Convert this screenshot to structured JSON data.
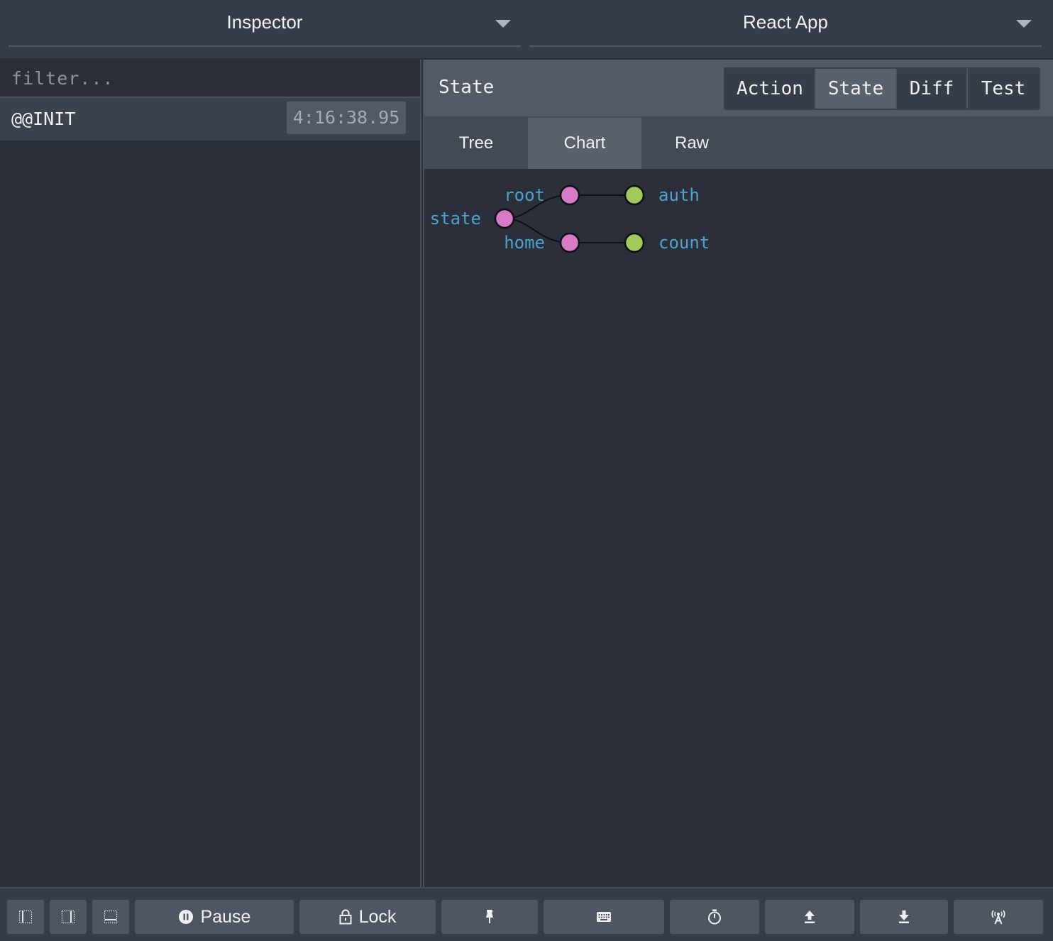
{
  "header": {
    "monitor_selector": "Inspector",
    "instance_selector": "React App"
  },
  "action_list": {
    "filter_placeholder": "filter...",
    "actions": [
      {
        "name": "@@INIT",
        "time": "4:16:38.95"
      }
    ]
  },
  "inspector": {
    "title": "State",
    "modes": [
      "Action",
      "State",
      "Diff",
      "Test"
    ],
    "active_mode": "State",
    "tabs": [
      "Tree",
      "Chart",
      "Raw"
    ],
    "active_tab": "Chart",
    "chart": {
      "nodes": {
        "state": "state",
        "root": "root",
        "home": "home",
        "auth": "auth",
        "count": "count"
      },
      "colors": {
        "parent_node": "#d97ac7",
        "leaf_node": "#a3c95a",
        "label": "#4ea2cc"
      }
    }
  },
  "toolbar": {
    "pause_label": "Pause",
    "lock_label": "Lock",
    "icons": [
      "dock-left-icon",
      "dock-bottom-icon",
      "dock-right-icon",
      "pause-icon",
      "lock-icon",
      "pin-icon",
      "keyboard-icon",
      "stopwatch-icon",
      "upload-icon",
      "download-icon",
      "remote-icon"
    ]
  }
}
